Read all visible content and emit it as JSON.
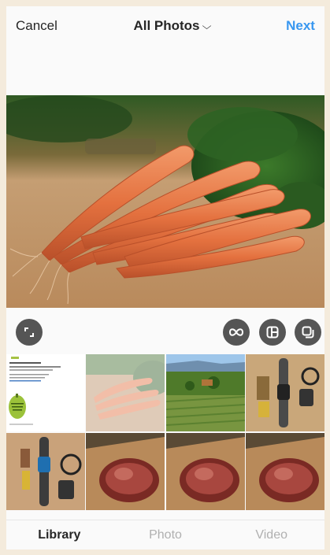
{
  "header": {
    "cancel_label": "Cancel",
    "title": "All Photos",
    "title_chevron": "⌵",
    "next_label": "Next"
  },
  "preview": {
    "subject": "carrots-photo"
  },
  "tools": {
    "expand_icon": "expand-icon",
    "boomerang_icon": "boomerang-icon",
    "layout_icon": "layout-icon",
    "multi_select_icon": "multi-select-icon"
  },
  "grid": {
    "rows": 2,
    "columns": 4,
    "items": [
      {
        "name": "thumb-newsletter",
        "selected": false
      },
      {
        "name": "thumb-carrots",
        "selected": true
      },
      {
        "name": "thumb-vineyard",
        "selected": false
      },
      {
        "name": "thumb-watch-1",
        "selected": false
      },
      {
        "name": "thumb-watch-2",
        "selected": false
      },
      {
        "name": "thumb-steak-1",
        "selected": false
      },
      {
        "name": "thumb-steak-2",
        "selected": false
      },
      {
        "name": "thumb-steak-3",
        "selected": false
      }
    ]
  },
  "tabs": [
    {
      "label": "Library",
      "active": true
    },
    {
      "label": "Photo",
      "active": false
    },
    {
      "label": "Video",
      "active": false
    }
  ],
  "colors": {
    "accent": "#3897f0",
    "text": "#262626",
    "inactive_tab": "#b0b0b0",
    "frame": "#f4ebdc"
  }
}
